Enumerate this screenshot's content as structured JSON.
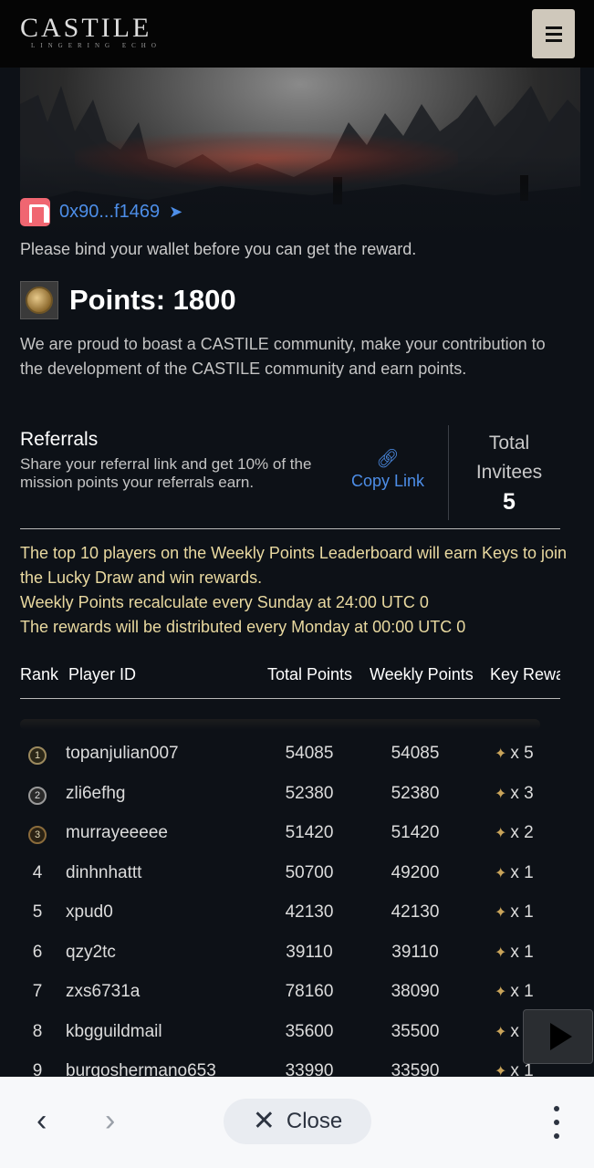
{
  "header": {
    "logo": "CASTILE",
    "logo_sub": "LINGERING ECHO"
  },
  "wallet": {
    "address": "0x90...f1469",
    "bind_message": "Please bind your wallet before you can get the reward."
  },
  "points": {
    "title": "Points: 1800",
    "description": "We are proud to boast a CASTILE community, make your contribution to the development of the CASTILE community and earn points."
  },
  "referrals": {
    "title": "Referrals",
    "subtitle": "Share your referral link and get 10% of the mission points your referrals earn.",
    "copy_link": "Copy Link",
    "invitees_label_1": "Total",
    "invitees_label_2": "Invitees",
    "invitees_count": "5"
  },
  "notice": {
    "line1": "The top 10 players on the Weekly Points Leaderboard will earn Keys to join the Lucky Draw and win rewards.",
    "line2": "Weekly Points recalculate every Sunday at 24:00 UTC 0",
    "line3": "The rewards will be distributed every Monday at 00:00 UTC 0"
  },
  "table": {
    "headers": {
      "rank": "Rank",
      "player_id": "Player ID",
      "total": "Total Points",
      "weekly": "Weekly Points",
      "key": "Key Reward"
    },
    "rows": [
      {
        "rank": "1",
        "player": "topanjulian007",
        "total": "54085",
        "weekly": "54085",
        "key": "x 5"
      },
      {
        "rank": "2",
        "player": "zli6efhg",
        "total": "52380",
        "weekly": "52380",
        "key": "x 3"
      },
      {
        "rank": "3",
        "player": "murrayeeeee",
        "total": "51420",
        "weekly": "51420",
        "key": "x 2"
      },
      {
        "rank": "4",
        "player": "dinhnhattt",
        "total": "50700",
        "weekly": "49200",
        "key": "x 1"
      },
      {
        "rank": "5",
        "player": "xpud0",
        "total": "42130",
        "weekly": "42130",
        "key": "x 1"
      },
      {
        "rank": "6",
        "player": "qzy2tc",
        "total": "39110",
        "weekly": "39110",
        "key": "x 1"
      },
      {
        "rank": "7",
        "player": "zxs6731a",
        "total": "78160",
        "weekly": "38090",
        "key": "x 1"
      },
      {
        "rank": "8",
        "player": "kbgguildmail",
        "total": "35600",
        "weekly": "35500",
        "key": "x 1"
      },
      {
        "rank": "9",
        "player": "burgoshermano653",
        "total": "33990",
        "weekly": "33590",
        "key": "x 1"
      }
    ]
  },
  "browser": {
    "close_label": "Close"
  }
}
